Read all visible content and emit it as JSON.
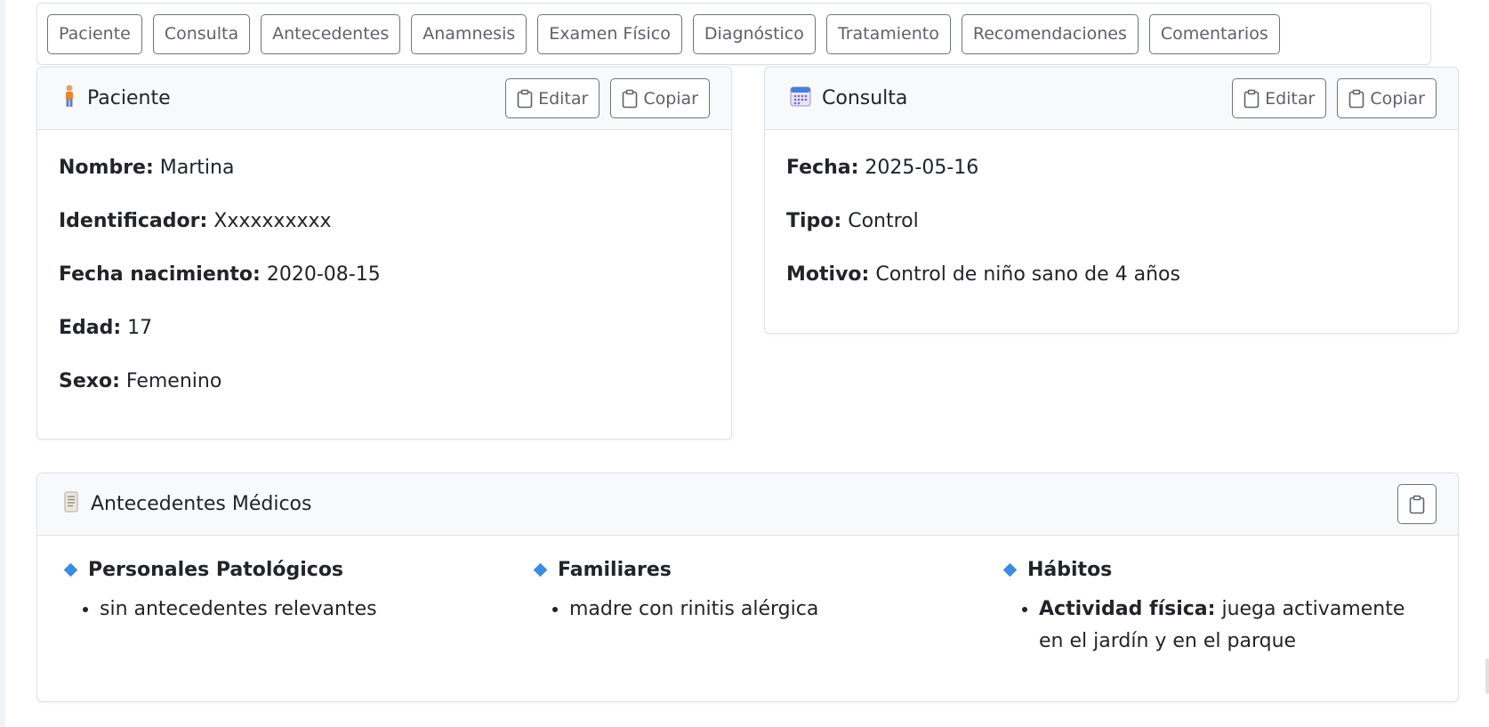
{
  "tabs": [
    "Paciente",
    "Consulta",
    "Antecedentes",
    "Anamnesis",
    "Examen Físico",
    "Diagnóstico",
    "Tratamiento",
    "Recomendaciones",
    "Comentarios"
  ],
  "paciente": {
    "title": "Paciente",
    "icon": "person-icon",
    "edit_label": "Editar",
    "copy_label": "Copiar",
    "fields": [
      {
        "label": "Nombre:",
        "value": "Martina"
      },
      {
        "label": "Identificador:",
        "value": "Xxxxxxxxxx"
      },
      {
        "label": "Fecha nacimiento:",
        "value": "2020-08-15"
      },
      {
        "label": "Edad:",
        "value": "17"
      },
      {
        "label": "Sexo:",
        "value": "Femenino"
      }
    ]
  },
  "consulta": {
    "title": "Consulta",
    "icon": "calendar-icon",
    "edit_label": "Editar",
    "copy_label": "Copiar",
    "fields": [
      {
        "label": "Fecha:",
        "value": "2025-05-16"
      },
      {
        "label": "Tipo:",
        "value": "Control"
      },
      {
        "label": "Motivo:",
        "value": "Control de niño sano de 4 años"
      }
    ]
  },
  "antecedentes": {
    "title": "Antecedentes Médicos",
    "icon": "scroll-icon",
    "sections": [
      {
        "heading": "Personales Patológicos",
        "items": [
          {
            "label": "",
            "text": "sin antecedentes relevantes"
          }
        ]
      },
      {
        "heading": "Familiares",
        "items": [
          {
            "label": "",
            "text": "madre con rinitis alérgica"
          }
        ]
      },
      {
        "heading": "Hábitos",
        "items": [
          {
            "label": "Actividad física:",
            "text": "juega activamente en el jardín y en el parque"
          }
        ]
      }
    ]
  },
  "colors": {
    "accent": "#3d8bdb",
    "border": "#dee2e6",
    "header_bg": "#f8f9fa",
    "button_border": "#6c757d"
  }
}
